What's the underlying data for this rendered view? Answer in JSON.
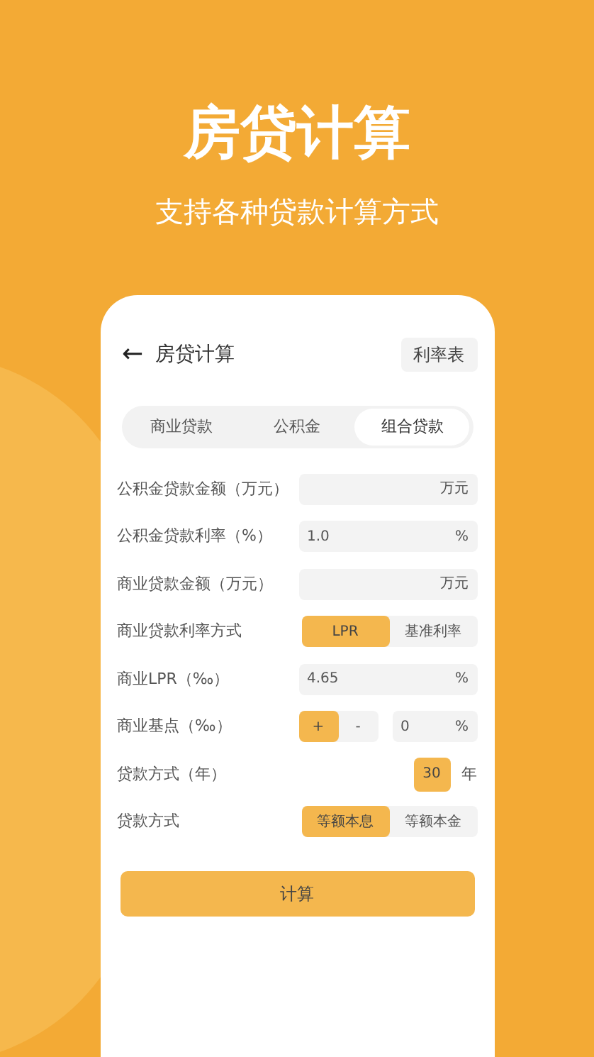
{
  "headline": "房贷计算",
  "subtitle": "支持各种贷款计算方式",
  "app": {
    "back": "←",
    "title": "房贷计算",
    "rate_table": "利率表",
    "tabs": [
      {
        "label": "商业贷款",
        "selected": false
      },
      {
        "label": "公积金",
        "selected": false
      },
      {
        "label": "组合贷款",
        "selected": true
      }
    ],
    "rows": [
      {
        "kind": "input",
        "label": "公积金贷款金额（万元）",
        "unit": "万元"
      },
      {
        "kind": "input",
        "label": "公积金贷款利率（%）",
        "value": "1.0",
        "unit": "%"
      },
      {
        "kind": "input",
        "label": "商业贷款金额（万元）",
        "unit": "万元"
      },
      {
        "kind": "toggle",
        "label": "商业贷款利率方式",
        "options": [
          {
            "label": "LPR",
            "selected": true
          },
          {
            "label": "基准利率",
            "selected": false
          }
        ]
      },
      {
        "kind": "input",
        "label": "商业LPR（‰）",
        "value": "4.65",
        "unit": "%"
      },
      {
        "kind": "stepper",
        "label": "商业基点（‰）",
        "options": [
          {
            "label": "+",
            "selected": true
          },
          {
            "label": "-",
            "selected": false
          }
        ],
        "value": "0",
        "unit": "%"
      },
      {
        "kind": "years",
        "label": "贷款方式（年）",
        "value": "30",
        "unit": "年"
      },
      {
        "kind": "toggle",
        "label": "贷款方式",
        "options": [
          {
            "label": "等额本息",
            "selected": true
          },
          {
            "label": "等额本金",
            "selected": false
          }
        ]
      }
    ],
    "calculate": "计算"
  }
}
